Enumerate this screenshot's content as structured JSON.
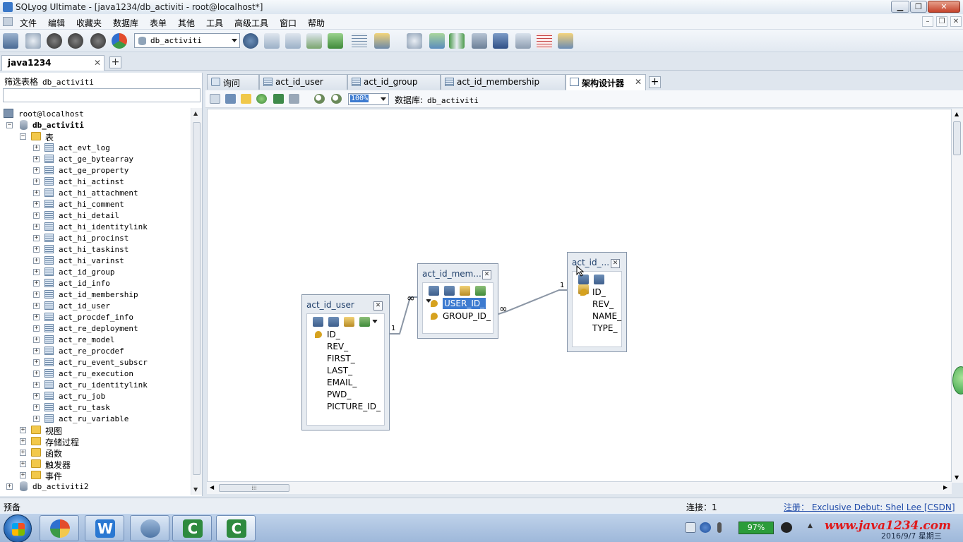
{
  "window": {
    "title": "SQLyog Ultimate - [java1234/db_activiti - root@localhost*]",
    "controls": {
      "minimize": "▁",
      "restore": "❐",
      "close": "✕"
    }
  },
  "menu": {
    "items": [
      "文件",
      "编辑",
      "收藏夹",
      "数据库",
      "表单",
      "其他",
      "工具",
      "高级工具",
      "窗口",
      "帮助"
    ],
    "mdi_controls": {
      "minimize": "–",
      "restore": "❐",
      "close": "✕"
    }
  },
  "toolbar": {
    "database_select": "db_activiti"
  },
  "connection_tab": {
    "label": "java1234",
    "close": "✕",
    "add": "+"
  },
  "object_browser": {
    "filter_label": "筛选表格",
    "filter_db": "db_activiti",
    "host": "root@localhost",
    "database": "db_activiti",
    "tables_folder": "表",
    "tables": [
      "act_evt_log",
      "act_ge_bytearray",
      "act_ge_property",
      "act_hi_actinst",
      "act_hi_attachment",
      "act_hi_comment",
      "act_hi_detail",
      "act_hi_identitylink",
      "act_hi_procinst",
      "act_hi_taskinst",
      "act_hi_varinst",
      "act_id_group",
      "act_id_info",
      "act_id_membership",
      "act_id_user",
      "act_procdef_info",
      "act_re_deployment",
      "act_re_model",
      "act_re_procdef",
      "act_ru_event_subscr",
      "act_ru_execution",
      "act_ru_identitylink",
      "act_ru_job",
      "act_ru_task",
      "act_ru_variable"
    ],
    "other_folders": [
      "视图",
      "存储过程",
      "函数",
      "触发器",
      "事件"
    ],
    "other_database": "db_activiti2",
    "expand_plus": "+",
    "expand_minus": "−"
  },
  "query_tabs": [
    {
      "label": "询问",
      "icon": "query-icon"
    },
    {
      "label": "act_id_user",
      "icon": "table-icon"
    },
    {
      "label": "act_id_group",
      "icon": "table-icon"
    },
    {
      "label": "act_id_membership",
      "icon": "table-icon"
    },
    {
      "label": "架构设计器",
      "icon": "schema-icon",
      "active": true,
      "close": "✕"
    }
  ],
  "query_tab_add": "+",
  "designer": {
    "zoom": "100%",
    "database_label": "数据库:",
    "database_name": "db_activiti",
    "tables": {
      "user": {
        "title": "act_id_user",
        "columns": [
          "ID_",
          "REV_",
          "FIRST_",
          "LAST_",
          "EMAIL_",
          "PWD_",
          "PICTURE_ID_"
        ],
        "close": "✕"
      },
      "membership": {
        "title": "act_id_mem...",
        "columns": [
          "USER_ID_",
          "GROUP_ID_"
        ],
        "close": "✕"
      },
      "group": {
        "title": "act_id_...",
        "columns": [
          "ID_",
          "REV_",
          "NAME_",
          "TYPE_"
        ],
        "close": "✕"
      }
    },
    "relations": {
      "one": "1",
      "many": "∞"
    }
  },
  "statusbar": {
    "left": "预备",
    "connections": "连接：1",
    "registration": "注册：  Exclusive Debut: Shel Lee [CSDN]"
  },
  "taskbar": {
    "battery": "97%",
    "clock": "2016/9/7 星期三",
    "watermark": "www.java1234.com"
  },
  "colors": {
    "selection": "#3d7bd0",
    "window_bg": "#dfe6ee",
    "link": "#1d49a8"
  }
}
